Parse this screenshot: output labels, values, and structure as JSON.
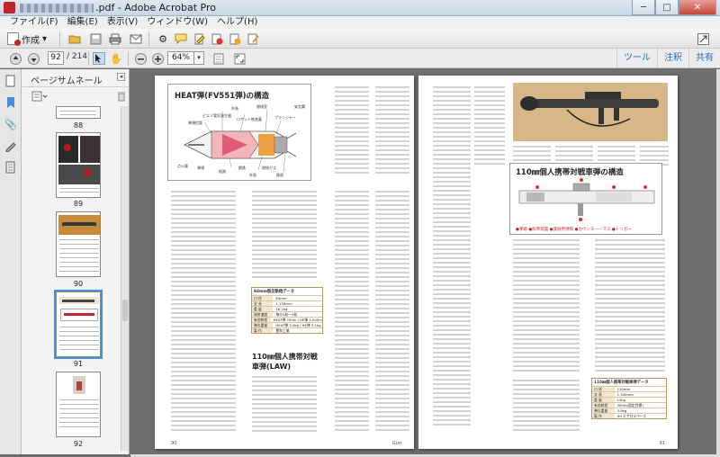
{
  "window": {
    "title": ".pdf - Adobe Acrobat Pro",
    "minimize": "─",
    "maximize": "□",
    "close": "✕"
  },
  "menu": [
    "ファイル(F)",
    "編集(E)",
    "表示(V)",
    "ウィンドウ(W)",
    "ヘルプ(H)"
  ],
  "toolbar": {
    "create_label": "作成",
    "create_dropdown": "▾"
  },
  "nav": {
    "page_current": "92",
    "page_total": "/ 214",
    "zoom_value": "64%",
    "zoom_dropdown": "▾"
  },
  "right_links": [
    "ツール",
    "注釈",
    "共有"
  ],
  "panel": {
    "title": "ページサムネール",
    "close_label": "◂",
    "thumb_labels": [
      "88",
      "89",
      "90",
      "91",
      "92"
    ]
  },
  "page_left": {
    "figure_title": "HEAT弾(FV551弾)の構造",
    "diagram_labels": [
      "外装",
      "ピエゾ電気発生器",
      "弾頭信管",
      "ロケット推進薬",
      "プランジャー",
      "燃焼室",
      "安定翼",
      "弾頭",
      "点火薬",
      "経路",
      "尾部",
      "外殻",
      "鋼鉄",
      "燃焼ガス"
    ],
    "spec_title": "84mm無反動砲データ",
    "spec_rows": [
      [
        "口 径",
        "84mm"
      ],
      [
        "全 長",
        "1,130mm"
      ],
      [
        "重 量",
        "16.7kg"
      ],
      [
        "発射速度",
        "毎分4発〜5発"
      ],
      [
        "有効射程",
        "HEAT弾 700m / HE弾 1,000m"
      ],
      [
        "弾丸重量",
        "HEAT弾 3.2kg / HE弾 3.1kg"
      ],
      [
        "製 作",
        "豊和工業"
      ]
    ],
    "section_heading_1": "110㎜個人携帯対戦",
    "section_heading_2": "車弾(LAW)",
    "page_number": "90",
    "footer_mark": "Gun"
  },
  "page_right": {
    "figure_title": "110㎜個人携帯対戦車弾の構造",
    "legend": "●弾頭 ●照準装置 ●発射用弾筒 ●カウンター・マス ●トリガー",
    "spec_title": "110㎜個人携帯対戦車弾データ",
    "spec_rows": [
      [
        "口 径",
        "110mm"
      ],
      [
        "全 長",
        "1,300mm"
      ],
      [
        "重 量",
        "13kg"
      ],
      [
        "有効射程",
        "300m(固定目標)"
      ],
      [
        "弾丸重量",
        "3.9kg"
      ],
      [
        "製 作",
        "IHI エアロスペース"
      ]
    ],
    "page_number": "91"
  },
  "colors": {
    "accent_link": "#2f6db4",
    "close_button": "#c4453a",
    "brand_red": "#c0272d"
  }
}
